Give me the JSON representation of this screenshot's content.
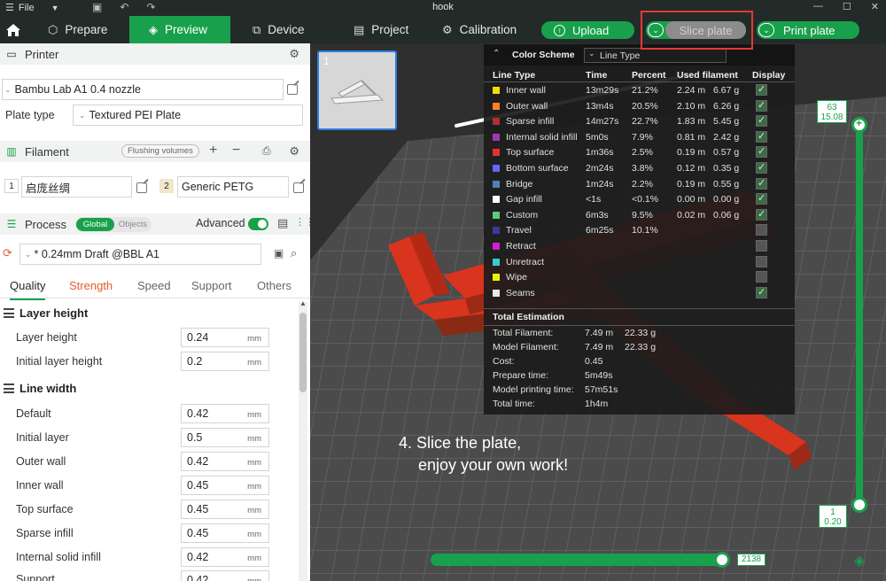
{
  "titlebar": {
    "menu_label": "File",
    "title": "hook"
  },
  "nav": {
    "prepare": "Prepare",
    "preview": "Preview",
    "device": "Device",
    "project": "Project",
    "calibration": "Calibration",
    "upload": "Upload",
    "slice_plate": "Slice plate",
    "print_plate": "Print plate"
  },
  "left": {
    "printer_header": "Printer",
    "printer_name": "Bambu Lab A1 0.4 nozzle",
    "plate_type_label": "Plate type",
    "plate_type_value": "Textured PEI Plate",
    "filament_header": "Filament",
    "flushing_label": "Flushing volumes",
    "filaments": [
      {
        "index": "1",
        "name": "启庞丝绸",
        "color": "#ffffff"
      },
      {
        "index": "2",
        "name": "Generic PETG",
        "color": "#f2e6c9"
      }
    ],
    "process_header": "Process",
    "global_label": "Global",
    "objects_label": "Objects",
    "advanced_label": "Advanced",
    "advanced_on": true,
    "preset": "* 0.24mm Draft @BBL A1",
    "tabs": [
      "Quality",
      "Strength",
      "Speed",
      "Support",
      "Others"
    ],
    "active_tab": "Quality",
    "groups": {
      "layer_height": {
        "title": "Layer height",
        "rows": [
          {
            "label": "Layer height",
            "value": "0.24",
            "unit": "mm"
          },
          {
            "label": "Initial layer height",
            "value": "0.2",
            "unit": "mm"
          }
        ]
      },
      "line_width": {
        "title": "Line width",
        "rows": [
          {
            "label": "Default",
            "value": "0.42",
            "unit": "mm"
          },
          {
            "label": "Initial layer",
            "value": "0.5",
            "unit": "mm"
          },
          {
            "label": "Outer wall",
            "value": "0.42",
            "unit": "mm"
          },
          {
            "label": "Inner wall",
            "value": "0.45",
            "unit": "mm"
          },
          {
            "label": "Top surface",
            "value": "0.45",
            "unit": "mm"
          },
          {
            "label": "Sparse infill",
            "value": "0.45",
            "unit": "mm"
          },
          {
            "label": "Internal solid infill",
            "value": "0.42",
            "unit": "mm"
          },
          {
            "label": "Support",
            "value": "0.42",
            "unit": "mm"
          }
        ]
      }
    }
  },
  "plate_thumb_number": "1",
  "scheme": {
    "title": "Color Scheme",
    "mode": "Line Type",
    "headers": [
      "Line Type",
      "Time",
      "Percent",
      "Used filament",
      "Display"
    ],
    "rows": [
      {
        "name": "Inner wall",
        "color": "#f0e000",
        "time": "13m29s",
        "percent": "21.2%",
        "len": "2.24 m",
        "weight": "6.67 g",
        "display": true
      },
      {
        "name": "Outer wall",
        "color": "#ff7f27",
        "time": "13m4s",
        "percent": "20.5%",
        "len": "2.10 m",
        "weight": "6.26 g",
        "display": true
      },
      {
        "name": "Sparse infill",
        "color": "#b03030",
        "time": "14m27s",
        "percent": "22.7%",
        "len": "1.83 m",
        "weight": "5.45 g",
        "display": true
      },
      {
        "name": "Internal solid infill",
        "color": "#9c3ab0",
        "time": "5m0s",
        "percent": "7.9%",
        "len": "0.81 m",
        "weight": "2.42 g",
        "display": true
      },
      {
        "name": "Top surface",
        "color": "#e83030",
        "time": "1m36s",
        "percent": "2.5%",
        "len": "0.19 m",
        "weight": "0.57 g",
        "display": true
      },
      {
        "name": "Bottom surface",
        "color": "#6666ff",
        "time": "2m24s",
        "percent": "3.8%",
        "len": "0.12 m",
        "weight": "0.35 g",
        "display": true
      },
      {
        "name": "Bridge",
        "color": "#4f82b5",
        "time": "1m24s",
        "percent": "2.2%",
        "len": "0.19 m",
        "weight": "0.55 g",
        "display": true
      },
      {
        "name": "Gap infill",
        "color": "#ffffff",
        "time": "<1s",
        "percent": "<0.1%",
        "len": "0.00 m",
        "weight": "0.00 g",
        "display": true
      },
      {
        "name": "Custom",
        "color": "#5fc97a",
        "time": "6m3s",
        "percent": "9.5%",
        "len": "0.02 m",
        "weight": "0.06 g",
        "display": true
      },
      {
        "name": "Travel",
        "color": "#3a3a9a",
        "time": "6m25s",
        "percent": "10.1%",
        "len": "",
        "weight": "",
        "display": false
      },
      {
        "name": "Retract",
        "color": "#d020d0",
        "time": "",
        "percent": "",
        "len": "",
        "weight": "",
        "display": false
      },
      {
        "name": "Unretract",
        "color": "#30d0d0",
        "time": "",
        "percent": "",
        "len": "",
        "weight": "",
        "display": false
      },
      {
        "name": "Wipe",
        "color": "#f0f000",
        "time": "",
        "percent": "",
        "len": "",
        "weight": "",
        "display": false
      },
      {
        "name": "Seams",
        "color": "#e8e8e8",
        "time": "",
        "percent": "",
        "len": "",
        "weight": "",
        "display": true
      }
    ],
    "total_title": "Total Estimation",
    "totals": [
      {
        "label": "Total Filament:",
        "v1": "7.49 m",
        "v2": "22.33 g"
      },
      {
        "label": "Model Filament:",
        "v1": "7.49 m",
        "v2": "22.33 g"
      },
      {
        "label": "Cost:",
        "v1": "0.45",
        "v2": ""
      },
      {
        "label": "Prepare time:",
        "v1": "5m49s",
        "v2": ""
      },
      {
        "label": "Model printing time:",
        "v1": "57m51s",
        "v2": ""
      },
      {
        "label": "Total time:",
        "v1": "1h4m",
        "v2": ""
      }
    ]
  },
  "tip_line1": "4. Slice the plate,",
  "tip_line2": "enjoy your own work!",
  "vslider": {
    "top_layer": "63",
    "top_height": "15.08",
    "bottom_layer": "1",
    "bottom_height": "0.20"
  },
  "hslider": {
    "value": "2138"
  }
}
